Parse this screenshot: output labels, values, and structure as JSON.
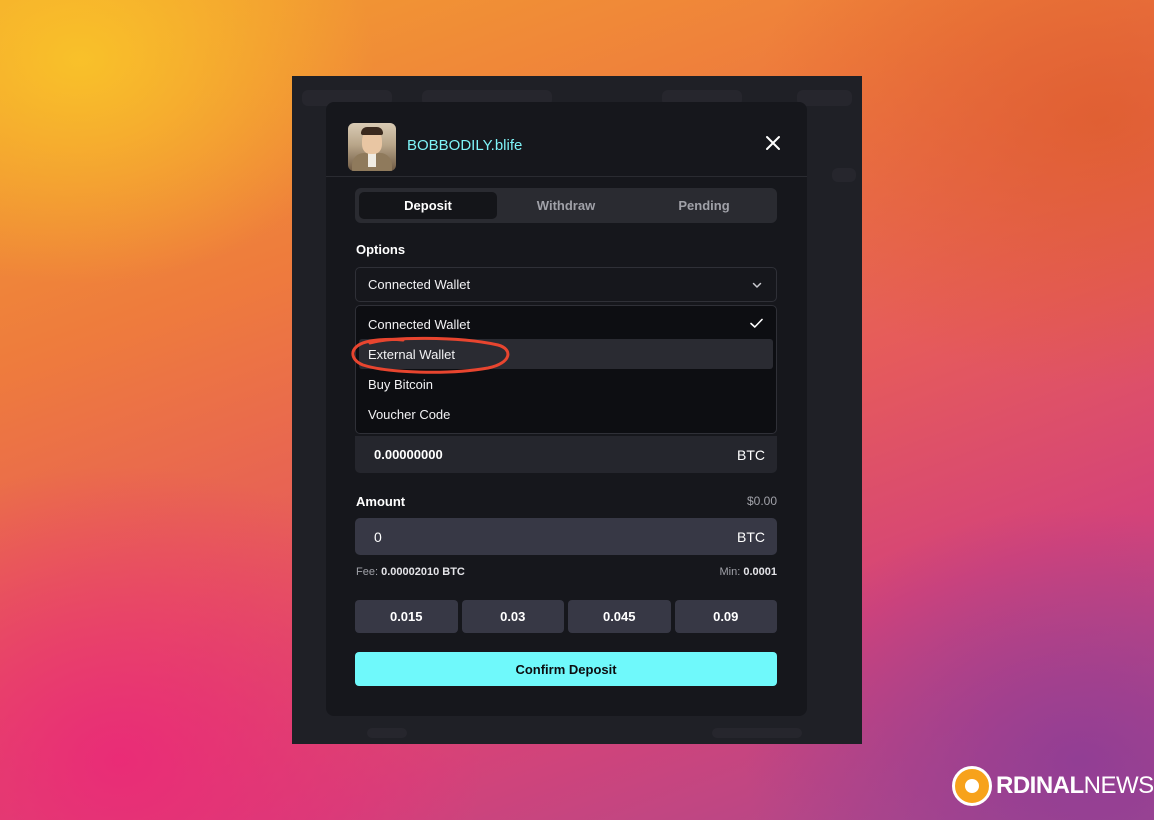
{
  "profile": {
    "username": "BOBBODILY.blife"
  },
  "tabs": [
    {
      "label": "Deposit",
      "active": true
    },
    {
      "label": "Withdraw",
      "active": false
    },
    {
      "label": "Pending",
      "active": false
    }
  ],
  "options": {
    "label": "Options",
    "selected": "Connected Wallet",
    "items": [
      {
        "label": "Connected Wallet",
        "checked": true
      },
      {
        "label": "External Wallet",
        "hovered": true
      },
      {
        "label": "Buy Bitcoin"
      },
      {
        "label": "Voucher Code"
      }
    ]
  },
  "balance": {
    "value": "0.00000000",
    "unit": "BTC"
  },
  "amount": {
    "label": "Amount",
    "usd": "$0.00",
    "value": "0",
    "unit": "BTC",
    "fee_label": "Fee:",
    "fee_value": "0.00002010 BTC",
    "min_label": "Min:",
    "min_value": "0.0001"
  },
  "presets": [
    "0.015",
    "0.03",
    "0.045",
    "0.09"
  ],
  "confirm_label": "Confirm Deposit",
  "watermark": {
    "brand_bold": "RDINAL",
    "brand_light": "NEWS"
  },
  "colors": {
    "accent": "#6ff9fb",
    "username": "#7ff3f7",
    "annotation": "#e8452f",
    "logo": "#f7a21b"
  }
}
